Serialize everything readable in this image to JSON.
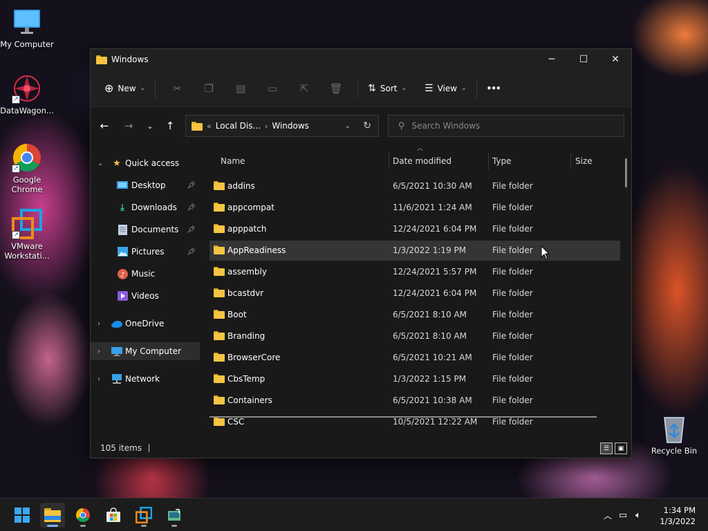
{
  "desktop": {
    "icons": [
      {
        "label": "My Computer"
      },
      {
        "label": "DataWagon..."
      },
      {
        "label": "Google Chrome"
      },
      {
        "label": "VMware Workstati..."
      },
      {
        "label": "Recycle Bin"
      }
    ]
  },
  "window": {
    "title": "Windows",
    "controls": {
      "minimize": "─",
      "maximize": "☐",
      "close": "✕"
    }
  },
  "commandbar": {
    "new_label": "New",
    "sort_label": "Sort",
    "view_label": "View",
    "more_label": "•••"
  },
  "navigation": {
    "address": {
      "overflow": "«",
      "segment1": "Local Dis...",
      "segment2": "Windows"
    },
    "search_placeholder": "Search Windows"
  },
  "nav_pane": {
    "quick_access": "Quick access",
    "items": [
      {
        "label": "Desktop",
        "pinned": true
      },
      {
        "label": "Downloads",
        "pinned": true
      },
      {
        "label": "Documents",
        "pinned": true
      },
      {
        "label": "Pictures",
        "pinned": true
      },
      {
        "label": "Music",
        "pinned": false
      },
      {
        "label": "Videos",
        "pinned": false
      }
    ],
    "onedrive": "OneDrive",
    "my_computer": "My Computer",
    "network": "Network"
  },
  "columns": {
    "name": "Name",
    "date": "Date modified",
    "type": "Type",
    "size": "Size"
  },
  "files": [
    {
      "name": "addins",
      "date": "6/5/2021 10:30 AM",
      "type": "File folder"
    },
    {
      "name": "appcompat",
      "date": "11/6/2021 1:24 AM",
      "type": "File folder"
    },
    {
      "name": "apppatch",
      "date": "12/24/2021 6:04 PM",
      "type": "File folder"
    },
    {
      "name": "AppReadiness",
      "date": "1/3/2022 1:19 PM",
      "type": "File folder"
    },
    {
      "name": "assembly",
      "date": "12/24/2021 5:57 PM",
      "type": "File folder"
    },
    {
      "name": "bcastdvr",
      "date": "12/24/2021 6:04 PM",
      "type": "File folder"
    },
    {
      "name": "Boot",
      "date": "6/5/2021 8:10 AM",
      "type": "File folder"
    },
    {
      "name": "Branding",
      "date": "6/5/2021 8:10 AM",
      "type": "File folder"
    },
    {
      "name": "BrowserCore",
      "date": "6/5/2021 10:21 AM",
      "type": "File folder"
    },
    {
      "name": "CbsTemp",
      "date": "1/3/2022 1:15 PM",
      "type": "File folder"
    },
    {
      "name": "Containers",
      "date": "6/5/2021 10:38 AM",
      "type": "File folder"
    },
    {
      "name": "CSC",
      "date": "10/5/2021 12:22 AM",
      "type": "File folder"
    }
  ],
  "status": {
    "item_count": "105 items"
  },
  "taskbar": {
    "clock_time": "1:34 PM",
    "clock_date": "1/3/2022"
  },
  "colors": {
    "accent": "#79b6ff",
    "folder": "#f6c443",
    "highlight": "#353535"
  }
}
